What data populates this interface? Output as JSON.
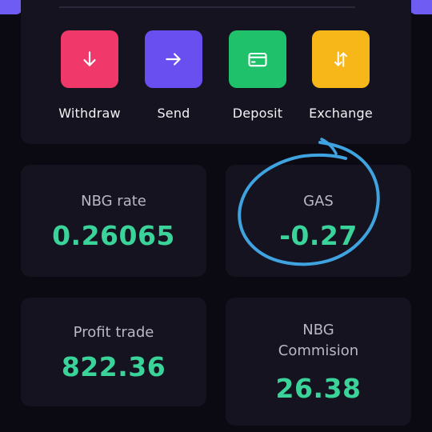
{
  "colors": {
    "background": "#0b0a12",
    "card": "#15131f",
    "accent": "#6f5cf2",
    "positive_value": "#3ad39a",
    "annotation_circle": "#3fa3e0"
  },
  "actions": [
    {
      "label": "Withdraw",
      "icon": "arrow-down-icon",
      "color": "#f0386b"
    },
    {
      "label": "Send",
      "icon": "arrow-right-icon",
      "color": "#6a4ff0"
    },
    {
      "label": "Deposit",
      "icon": "card-icon",
      "color": "#1fc16b"
    },
    {
      "label": "Exchange",
      "icon": "exchange-arrows-icon",
      "color": "#f7b718"
    }
  ],
  "stats": {
    "nbg_rate": {
      "title": "NBG rate",
      "value": "0.26065"
    },
    "gas": {
      "title": "GAS",
      "value": "-0.27"
    },
    "profit_trade": {
      "title": "Profit trade",
      "value": "822.36"
    },
    "nbg_commission": {
      "title_line1": "NBG",
      "title_line2": "Commision",
      "value": "26.38"
    }
  }
}
